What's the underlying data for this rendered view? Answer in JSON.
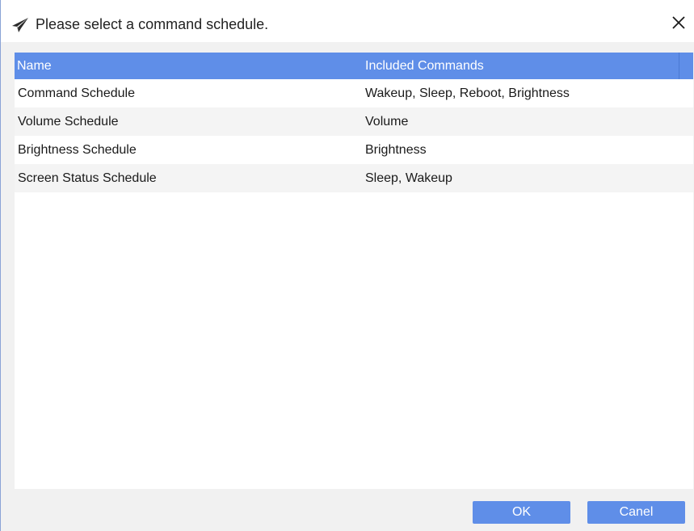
{
  "dialog": {
    "title": "Please select a command schedule.",
    "title_icon": "paper-plane-icon",
    "close_icon": "close-icon"
  },
  "table": {
    "columns": [
      "Name",
      "Included Commands"
    ],
    "rows": [
      {
        "name": "Command Schedule",
        "commands": "Wakeup, Sleep, Reboot, Brightness"
      },
      {
        "name": "Volume Schedule",
        "commands": "Volume"
      },
      {
        "name": "Brightness Schedule",
        "commands": "Brightness"
      },
      {
        "name": "Screen Status Schedule",
        "commands": "Sleep, Wakeup"
      }
    ]
  },
  "buttons": {
    "ok_label": "OK",
    "cancel_label": "Canel"
  },
  "colors": {
    "accent": "#5f8ee8",
    "header_text": "#ffffff",
    "content_bg": "#f1f1f1"
  }
}
